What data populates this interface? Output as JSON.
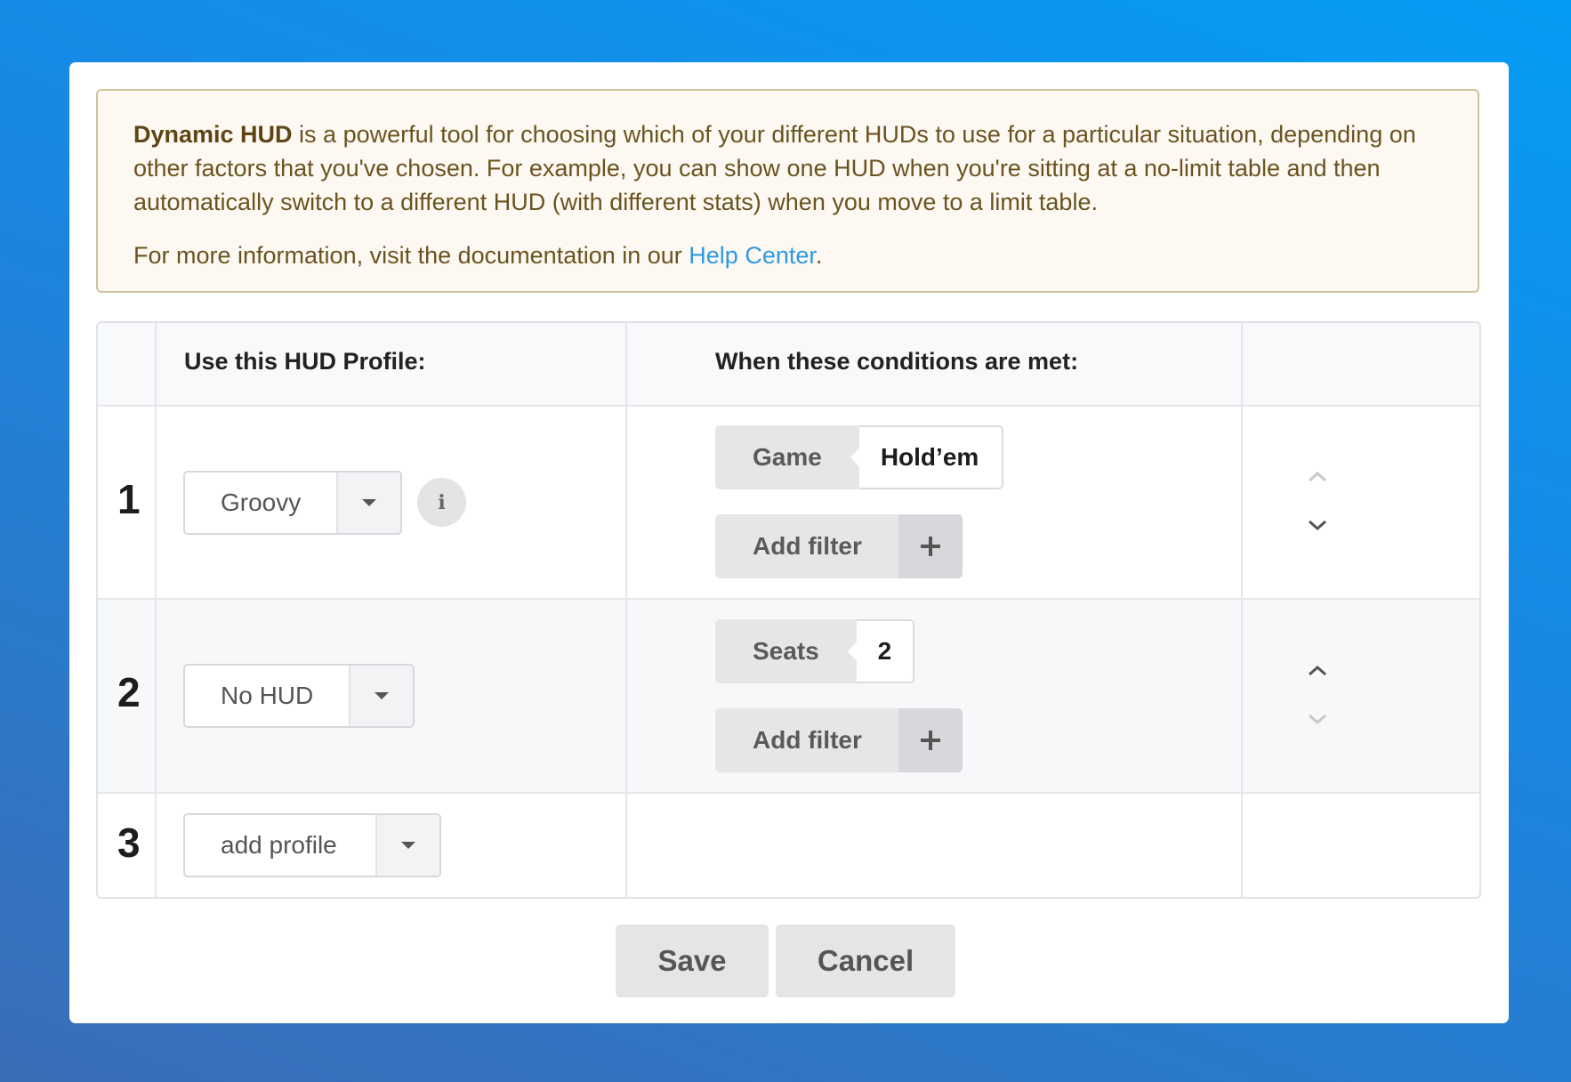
{
  "notice": {
    "brand": "Dynamic HUD",
    "description": " is a powerful tool for choosing which of your different HUDs to use for a particular situation, depending on other factors that you've chosen. For example, you can show one HUD when you're sitting at a no-limit table and then automatically switch to a different HUD (with different stats) when you move to a limit table.",
    "more_info_prefix": "For more information, visit the documentation in our ",
    "help_link": "Help Center",
    "more_info_suffix": "."
  },
  "table": {
    "header_profile": "Use this HUD Profile:",
    "header_conditions": "When these conditions are met:",
    "rows": [
      {
        "number": "1",
        "profile": "Groovy",
        "info_glyph": "i",
        "conditions": [
          {
            "key": "Game",
            "value": "Hold’em"
          }
        ],
        "add_filter_label": "Add filter",
        "add_filter_glyph": "+"
      },
      {
        "number": "2",
        "profile": "No HUD",
        "conditions": [
          {
            "key": "Seats",
            "value": "2"
          }
        ],
        "add_filter_label": "Add filter",
        "add_filter_glyph": "+"
      },
      {
        "number": "3",
        "profile_placeholder": "add profile"
      }
    ]
  },
  "actions": {
    "save_label": "Save",
    "cancel_label": "Cancel"
  },
  "icons": {
    "info": "info-icon",
    "caret": "caret-down-icon",
    "plus": "plus-icon",
    "move_up": "chevron-up-icon",
    "move_down": "chevron-down-icon"
  },
  "colors": {
    "link": "#2f99e3",
    "notice_background": "#fdf9f2",
    "notice_border": "#cfc39c",
    "button_background": "#e4e5e7"
  }
}
